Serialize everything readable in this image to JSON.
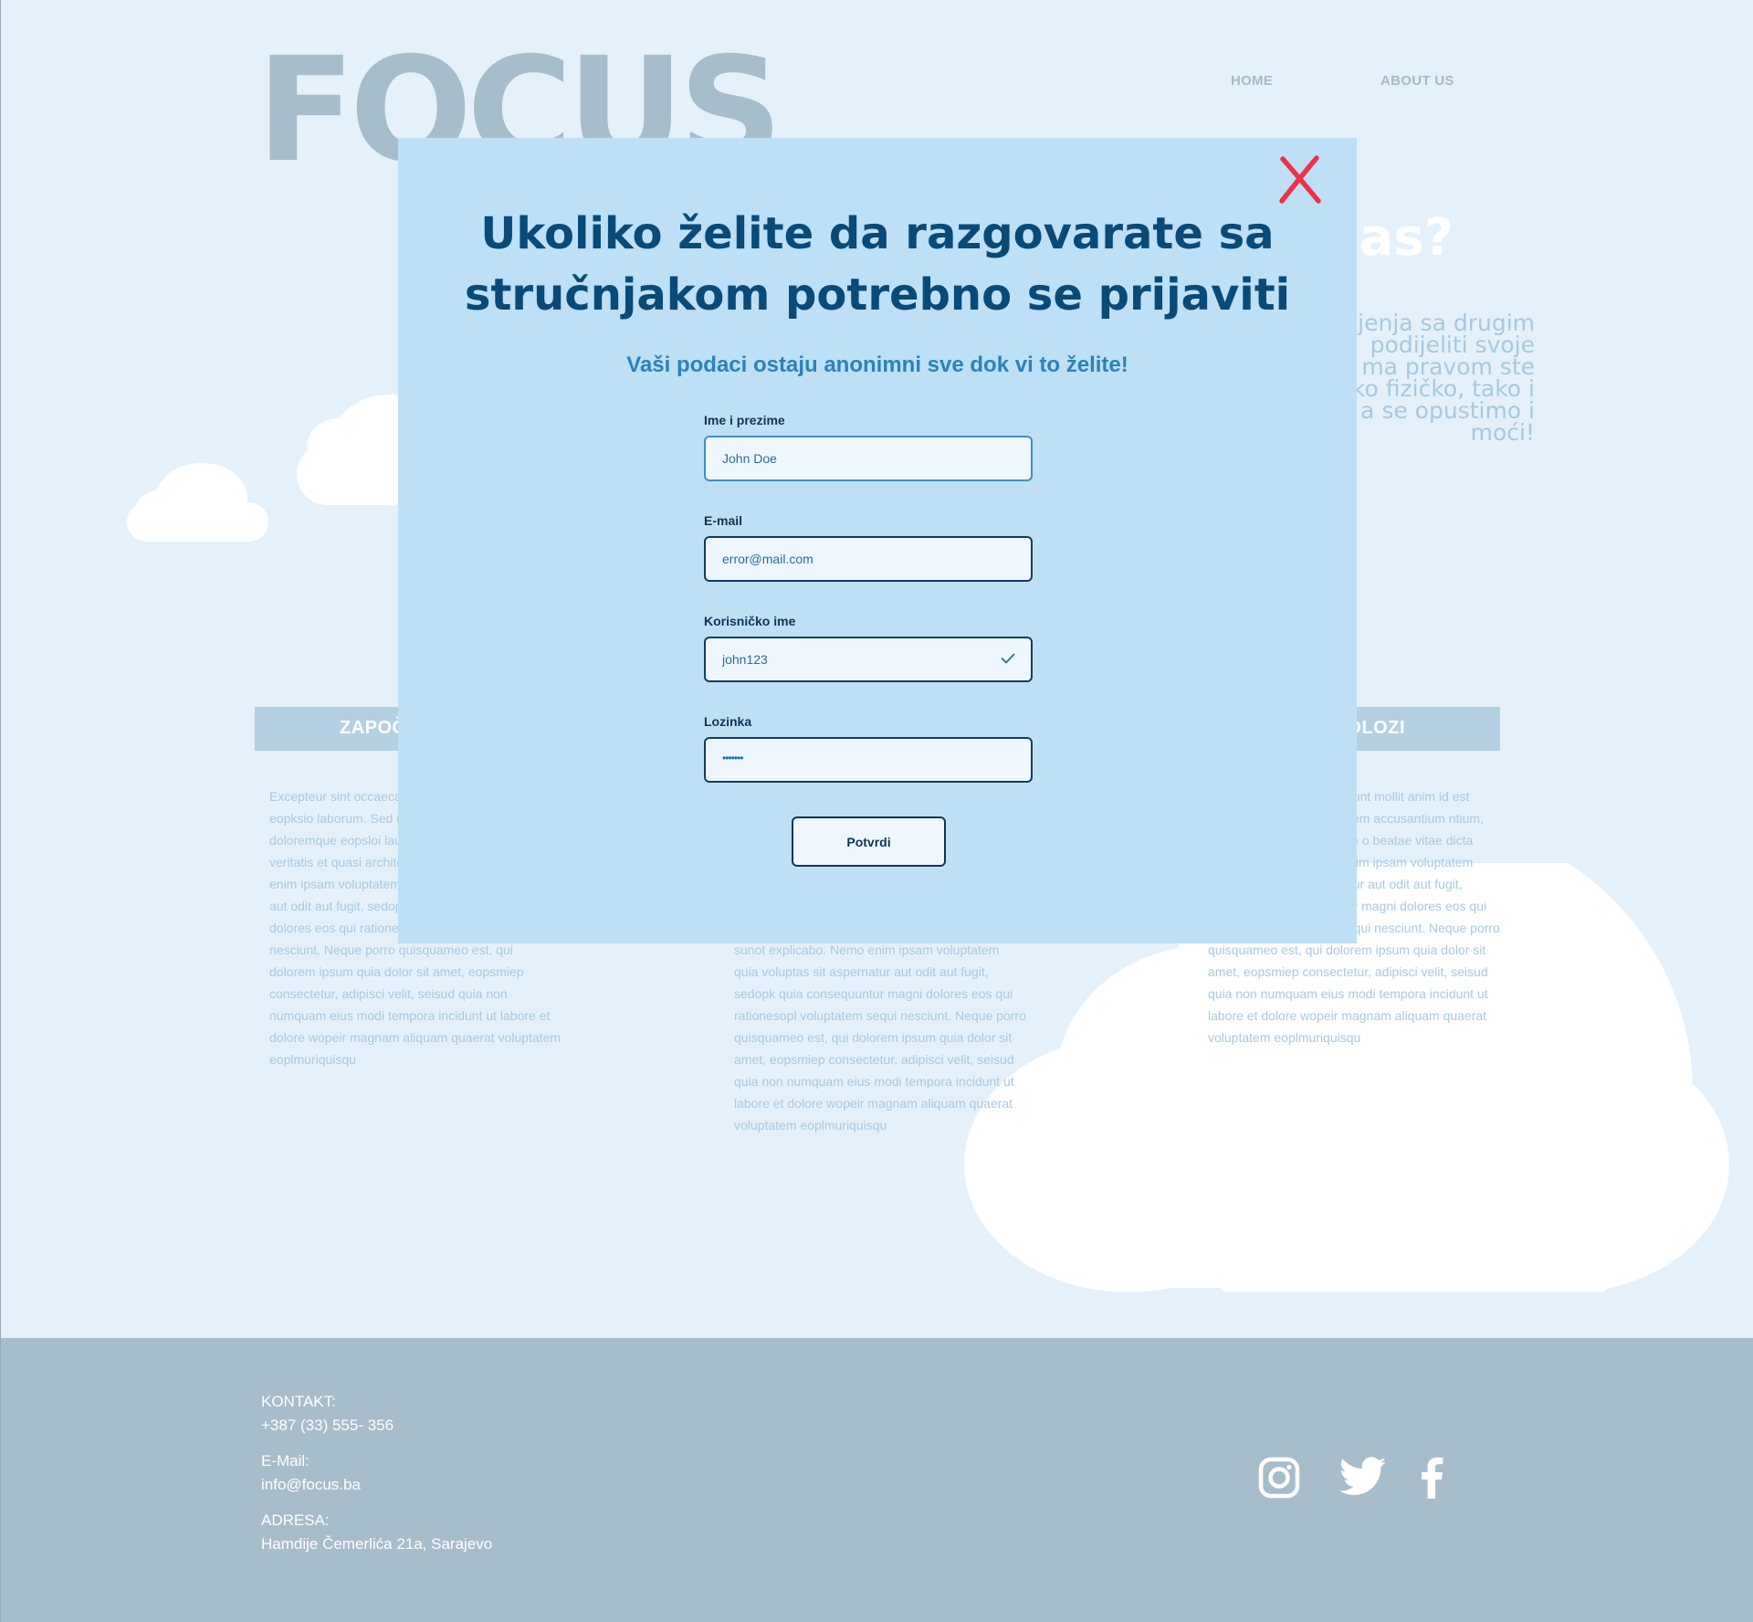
{
  "header": {
    "logo": "FOCUS",
    "nav": [
      {
        "label": "HOME"
      },
      {
        "label": "ABOUT US"
      }
    ]
  },
  "hero": {
    "title_fragment": "anas?",
    "text_fragments": [
      "šljenja sa drugim",
      "podijeliti svoje",
      "ma pravom ste",
      "ako fizičko, tako i",
      "a se opustimo i",
      "moći!"
    ]
  },
  "bar": {
    "left_label": "ZAPOČ",
    "right_label": "OLOZI"
  },
  "columns": {
    "col1": "Excepteur sint occaeca sunt in culpa qui officia eopksio laborum. Sed ut istpoe natus error sit vo doloremque eopsloi lau aperiam, eaque ipsa qu veritatis et quasi archite sunot explicabo. Nemo enim ipsam voluptatem quia voluptas sit aspernatur aut odit aut fugit, sedopk quia consequuntur magni dolores eos qui rationesopl voluptatem sequi nesciunt. Neque porro quisquameo est, qui dolorem ipsum quia dolor sit amet, eopsmiep consectetur, adipisci velit, seisud quia non numquam eius modi tempora incidunt ut labore et dolore wopeir magnam aliquam quaerat voluptatem eoplmuriquisqu",
    "col2": "sunot explicabo. Nemo enim ipsam voluptatem quia voluptas sit aspernatur aut odit aut fugit, sedopk quia consequuntur magni dolores eos qui rationesopl voluptatem sequi nesciunt. Neque porro quisquameo est, qui dolorem ipsum quia dolor sit amet, eopsmiep consectetur, adipisci velit, seisud quia non numquam eius modi tempora incidunt ut labore et dolore wopeir magnam aliquam quaerat voluptatem eoplmuriquisqu",
    "col3": "upidatat non proident, serunt mollit anim id est erspiciatis unde omnis tatem accusantium ntium, totam rem ab illo inventore o beatae vitae dicta sunot explicabo. Nemo enim ipsam voluptatem quia voluptas sit aspernatur aut odit aut fugit, sedopk quia consequuntur magni dolores eos qui rationesopl voluptatem sequi nesciunt. Neque porro quisquameo est, qui dolorem ipsum quia dolor sit amet, eopsmiep consectetur, adipisci velit, seisud quia non numquam eius modi tempora incidunt ut labore et dolore wopeir magnam aliquam quaerat voluptatem eoplmuriquisqu"
  },
  "modal": {
    "title_line1": "Ukoliko želite da razgovarate sa",
    "title_line2": "stručnjakom potrebno se prijaviti",
    "subtitle": "Vaši podaci ostaju anonimni sve dok vi to želite!",
    "fields": {
      "name": {
        "label": "Ime i prezime",
        "value": "John Doe"
      },
      "email": {
        "label": "E-mail",
        "value": "error@mail.com"
      },
      "username": {
        "label": "Korisničko ime",
        "value": "john123"
      },
      "password": {
        "label": "Lozinka",
        "value": "•••••••"
      }
    },
    "submit_label": "Potvrdi"
  },
  "footer": {
    "kontakt_label": "KONTAKT:",
    "phone": "+387 (33) 555- 356",
    "email_label": "E-Mail:",
    "email": "info@focus.ba",
    "adresa_label": "ADRESA:",
    "address": "Hamdije Čemerlića 21a, Sarajevo",
    "social_icons": [
      "instagram-icon",
      "twitter-icon",
      "facebook-icon"
    ]
  },
  "colors": {
    "page_bg": "#e4f1fb",
    "modal_bg": "#bde0f7",
    "title": "#0b4a77",
    "subtitle": "#2d81b8",
    "close": "#f0304a",
    "footer_bg": "#a7bdcc",
    "logo": "#a6bdcc"
  }
}
